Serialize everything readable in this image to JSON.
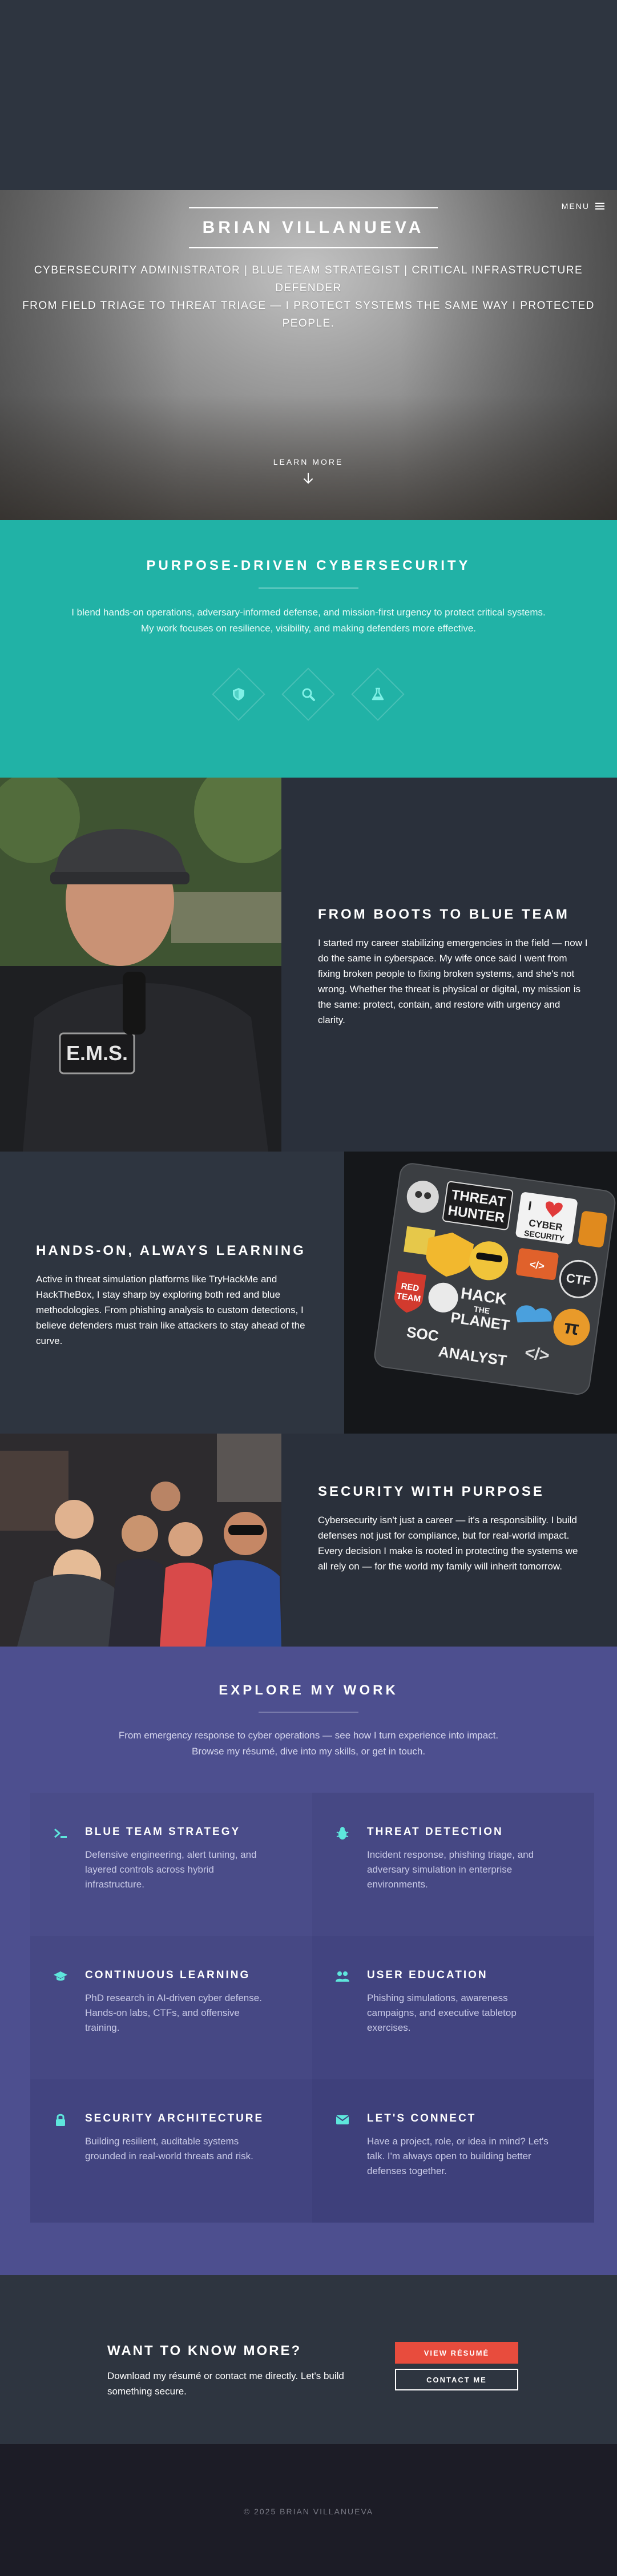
{
  "nav": {
    "menu_label": "MENU"
  },
  "hero": {
    "title": "BRIAN VILLANUEVA",
    "subtitle_line1": "CYBERSECURITY ADMINISTRATOR | BLUE TEAM STRATEGIST | CRITICAL INFRASTRUCTURE DEFENDER",
    "subtitle_line2": "FROM FIELD TRIAGE TO THREAT TRIAGE — I PROTECT SYSTEMS THE SAME WAY I PROTECTED PEOPLE.",
    "learn_more": "LEARN MORE"
  },
  "purpose": {
    "heading": "PURPOSE-DRIVEN CYBERSECURITY",
    "text_line1": "I blend hands-on operations, adversary-informed defense, and mission-first urgency to protect critical systems.",
    "text_line2": "My work focuses on resilience, visibility, and making defenders more effective.",
    "icons": [
      "shield-icon",
      "search-icon",
      "flask-icon"
    ],
    "icon_color": "#7ff0e6"
  },
  "spotlights": [
    {
      "heading": "FROM BOOTS TO BLUE TEAM",
      "text": "I started my career stabilizing emergencies in the field — now I do the same in cyberspace. My wife once said I went from fixing broken people to fixing broken systems, and she's not wrong. Whether the threat is physical or digital, my mission is the same: protect, contain, and restore with urgency and clarity.",
      "patch_text": "E.M.S."
    },
    {
      "heading": "HANDS-ON, ALWAYS LEARNING",
      "text": "Active in threat simulation platforms like TryHackMe and HackTheBox, I stay sharp by exploring both red and blue methodologies. From phishing analysis to custom detections, I believe defenders must train like attackers to stay ahead of the curve.",
      "stickers": [
        "THREAT",
        "HUNTER",
        "I",
        "CYBER",
        "SECURITY",
        "CTF",
        "RED",
        "TEAM",
        "HACK",
        "THE",
        "PLANET",
        "SOC",
        "ANALYST"
      ]
    },
    {
      "heading": "SECURITY WITH PURPOSE",
      "text": "Cybersecurity isn't just a career — it's a responsibility. I build defenses not just for compliance, but for real-world impact. Every decision I make is rooted in protecting the systems we all rely on — for the world my family will inherit tomorrow."
    }
  ],
  "explore": {
    "heading": "EXPLORE MY WORK",
    "intro_line1": "From emergency response to cyber operations — see how I turn experience into impact.",
    "intro_line2": "Browse my résumé, dive into my skills, or get in touch.",
    "accent_color": "#5ee6dc",
    "cards": [
      {
        "icon": "terminal-icon",
        "title": "BLUE TEAM STRATEGY",
        "text": "Defensive engineering, alert tuning, and layered controls across hybrid infrastructure."
      },
      {
        "icon": "bug-icon",
        "title": "THREAT DETECTION",
        "text": "Incident response, phishing triage, and adversary simulation in enterprise environments."
      },
      {
        "icon": "graduation-cap-icon",
        "title": "CONTINUOUS LEARNING",
        "text": "PhD research in AI-driven cyber defense. Hands-on labs, CTFs, and offensive training."
      },
      {
        "icon": "users-icon",
        "title": "USER EDUCATION",
        "text": "Phishing simulations, awareness campaigns, and executive tabletop exercises."
      },
      {
        "icon": "lock-icon",
        "title": "SECURITY ARCHITECTURE",
        "text": "Building resilient, auditable systems grounded in real-world threats and risk."
      },
      {
        "icon": "envelope-icon",
        "title": "LET'S CONNECT",
        "text": "Have a project, role, or idea in mind? Let's talk. I'm always open to building better defenses together."
      }
    ]
  },
  "cta": {
    "heading": "WANT TO KNOW MORE?",
    "text": "Download my résumé or contact me directly. Let's build something secure.",
    "primary_button": "VIEW RÉSUMÉ",
    "secondary_button": "CONTACT ME",
    "primary_color": "#e84c3d"
  },
  "footer": {
    "copyright": "© 2025 BRIAN VILLANUEVA"
  }
}
